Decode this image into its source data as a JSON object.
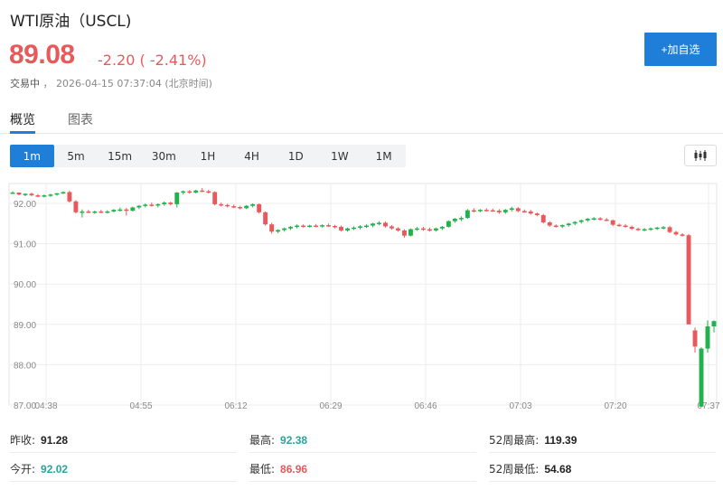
{
  "header": {
    "title": "WTI原油（USCL)",
    "price": "89.08",
    "change": "-2.20 ( -2.41%)",
    "state": "交易中",
    "timestamp": "2026-04-15 07:37:04 (北京时间)",
    "watch_label": "+加自选"
  },
  "tabs": [
    {
      "label": "概览",
      "active": true
    },
    {
      "label": "图表",
      "active": false
    }
  ],
  "periods": [
    {
      "label": "1m",
      "active": true
    },
    {
      "label": "5m",
      "active": false
    },
    {
      "label": "15m",
      "active": false
    },
    {
      "label": "30m",
      "active": false
    },
    {
      "label": "1H",
      "active": false
    },
    {
      "label": "4H",
      "active": false
    },
    {
      "label": "1D",
      "active": false
    },
    {
      "label": "1W",
      "active": false
    },
    {
      "label": "1M",
      "active": false
    }
  ],
  "chart_type_icon": "candlestick-icon",
  "stats": [
    {
      "label": "昨收:",
      "value": "91.28",
      "tone": "neutral"
    },
    {
      "label": "最高:",
      "value": "92.38",
      "tone": "up"
    },
    {
      "label": "52周最高:",
      "value": "119.39",
      "tone": "neutral"
    },
    {
      "label": "今开:",
      "value": "92.02",
      "tone": "up"
    },
    {
      "label": "最低:",
      "value": "86.96",
      "tone": "down"
    },
    {
      "label": "52周最低:",
      "value": "54.68",
      "tone": "neutral"
    }
  ],
  "colors": {
    "up": "#26a69a",
    "down": "#e8595b",
    "accent": "#1e7ed8",
    "candle_up": "#22b14c"
  },
  "chart_data": {
    "type": "candlestick",
    "ylim": [
      86.96,
      92.4
    ],
    "y_ticks": [
      "92.00",
      "91.00",
      "90.00",
      "89.00",
      "88.00",
      "87.00"
    ],
    "x_ticks": [
      "04:38",
      "04:55",
      "06:12",
      "06:29",
      "06:46",
      "07:03",
      "07:20",
      "07:37"
    ],
    "grid": true,
    "candles": [
      [
        92.27,
        92.3,
        92.24,
        92.27
      ],
      [
        92.27,
        92.27,
        92.2,
        92.22
      ],
      [
        92.22,
        92.25,
        92.18,
        92.24
      ],
      [
        92.24,
        92.27,
        92.18,
        92.2
      ],
      [
        92.2,
        92.23,
        92.15,
        92.17
      ],
      [
        92.17,
        92.22,
        92.15,
        92.2
      ],
      [
        92.2,
        92.24,
        92.16,
        92.22
      ],
      [
        92.22,
        92.26,
        92.19,
        92.25
      ],
      [
        92.25,
        92.3,
        92.23,
        92.28
      ],
      [
        92.28,
        92.32,
        92.02,
        92.05
      ],
      [
        92.05,
        92.08,
        91.75,
        91.78
      ],
      [
        91.78,
        91.85,
        91.65,
        91.8
      ],
      [
        91.8,
        91.84,
        91.76,
        91.78
      ],
      [
        91.78,
        91.82,
        91.74,
        91.8
      ],
      [
        91.8,
        91.84,
        91.76,
        91.79
      ],
      [
        91.79,
        91.83,
        91.75,
        91.8
      ],
      [
        91.8,
        91.86,
        91.78,
        91.84
      ],
      [
        91.84,
        91.9,
        91.8,
        91.85
      ],
      [
        91.85,
        91.89,
        91.7,
        91.82
      ],
      [
        91.82,
        91.92,
        91.8,
        91.9
      ],
      [
        91.9,
        91.96,
        91.86,
        91.94
      ],
      [
        91.94,
        92.0,
        91.9,
        91.97
      ],
      [
        91.97,
        92.02,
        91.92,
        91.95
      ],
      [
        91.95,
        92.0,
        91.9,
        91.98
      ],
      [
        91.98,
        92.05,
        91.94,
        92.02
      ],
      [
        92.02,
        92.04,
        91.95,
        91.98
      ],
      [
        91.98,
        92.28,
        91.9,
        92.27
      ],
      [
        92.27,
        92.32,
        92.22,
        92.3
      ],
      [
        92.3,
        92.33,
        92.24,
        92.27
      ],
      [
        92.27,
        92.34,
        92.25,
        92.32
      ],
      [
        92.32,
        92.38,
        92.28,
        92.3
      ],
      [
        92.3,
        92.34,
        92.25,
        92.28
      ],
      [
        92.28,
        92.3,
        91.95,
        91.98
      ],
      [
        91.98,
        92.02,
        91.92,
        91.96
      ],
      [
        91.96,
        91.99,
        91.9,
        91.93
      ],
      [
        91.93,
        91.97,
        91.88,
        91.91
      ],
      [
        91.91,
        91.94,
        91.85,
        91.88
      ],
      [
        91.88,
        91.96,
        91.86,
        91.94
      ],
      [
        91.94,
        92.0,
        91.9,
        91.98
      ],
      [
        91.98,
        92.0,
        91.75,
        91.78
      ],
      [
        91.78,
        91.8,
        91.45,
        91.48
      ],
      [
        91.48,
        91.52,
        91.25,
        91.3
      ],
      [
        91.3,
        91.36,
        91.26,
        91.34
      ],
      [
        91.34,
        91.4,
        91.3,
        91.38
      ],
      [
        91.38,
        91.44,
        91.34,
        91.42
      ],
      [
        91.42,
        91.48,
        91.38,
        91.45
      ],
      [
        91.45,
        91.48,
        91.4,
        91.43
      ],
      [
        91.43,
        91.47,
        91.4,
        91.45
      ],
      [
        91.45,
        91.49,
        91.41,
        91.44
      ],
      [
        91.44,
        91.48,
        91.4,
        91.46
      ],
      [
        91.46,
        91.5,
        91.42,
        91.44
      ],
      [
        91.44,
        91.47,
        91.38,
        91.42
      ],
      [
        91.42,
        91.45,
        91.3,
        91.33
      ],
      [
        91.33,
        91.4,
        91.3,
        91.38
      ],
      [
        91.38,
        91.43,
        91.34,
        91.4
      ],
      [
        91.4,
        91.46,
        91.36,
        91.43
      ],
      [
        91.43,
        91.48,
        91.39,
        91.45
      ],
      [
        91.45,
        91.52,
        91.41,
        91.5
      ],
      [
        91.5,
        91.56,
        91.46,
        91.52
      ],
      [
        91.52,
        91.55,
        91.4,
        91.43
      ],
      [
        91.43,
        91.46,
        91.35,
        91.38
      ],
      [
        91.38,
        91.41,
        91.3,
        91.33
      ],
      [
        91.33,
        91.36,
        91.15,
        91.2
      ],
      [
        91.2,
        91.38,
        91.18,
        91.36
      ],
      [
        91.36,
        91.42,
        91.32,
        91.38
      ],
      [
        91.38,
        91.42,
        91.32,
        91.36
      ],
      [
        91.36,
        91.4,
        91.3,
        91.33
      ],
      [
        91.33,
        91.4,
        91.3,
        91.38
      ],
      [
        91.38,
        91.44,
        91.34,
        91.42
      ],
      [
        91.42,
        91.58,
        91.4,
        91.56
      ],
      [
        91.56,
        91.64,
        91.52,
        91.62
      ],
      [
        91.62,
        91.68,
        91.56,
        91.64
      ],
      [
        91.64,
        91.86,
        91.62,
        91.83
      ],
      [
        91.83,
        91.88,
        91.78,
        91.82
      ],
      [
        91.82,
        91.86,
        91.78,
        91.84
      ],
      [
        91.84,
        91.88,
        91.8,
        91.83
      ],
      [
        91.83,
        91.87,
        91.79,
        91.82
      ],
      [
        91.82,
        91.86,
        91.74,
        91.78
      ],
      [
        91.78,
        91.86,
        91.74,
        91.84
      ],
      [
        91.84,
        91.92,
        91.8,
        91.88
      ],
      [
        91.88,
        91.91,
        91.78,
        91.81
      ],
      [
        91.81,
        91.85,
        91.77,
        91.8
      ],
      [
        91.8,
        91.84,
        91.72,
        91.75
      ],
      [
        91.75,
        91.78,
        91.68,
        91.71
      ],
      [
        91.71,
        91.74,
        91.5,
        91.53
      ],
      [
        91.53,
        91.56,
        91.42,
        91.45
      ],
      [
        91.45,
        91.48,
        91.4,
        91.43
      ],
      [
        91.43,
        91.48,
        91.39,
        91.46
      ],
      [
        91.46,
        91.52,
        91.42,
        91.5
      ],
      [
        91.5,
        91.56,
        91.46,
        91.54
      ],
      [
        91.54,
        91.6,
        91.5,
        91.58
      ],
      [
        91.58,
        91.64,
        91.54,
        91.62
      ],
      [
        91.62,
        91.66,
        91.58,
        91.63
      ],
      [
        91.63,
        91.66,
        91.58,
        91.6
      ],
      [
        91.6,
        91.64,
        91.56,
        91.58
      ],
      [
        91.58,
        91.6,
        91.44,
        91.47
      ],
      [
        91.47,
        91.5,
        91.42,
        91.45
      ],
      [
        91.45,
        91.49,
        91.4,
        91.42
      ],
      [
        91.42,
        91.45,
        91.34,
        91.37
      ],
      [
        91.37,
        91.4,
        91.32,
        91.35
      ],
      [
        91.35,
        91.39,
        91.31,
        91.36
      ],
      [
        91.36,
        91.4,
        91.32,
        91.38
      ],
      [
        91.38,
        91.42,
        91.34,
        91.4
      ],
      [
        91.4,
        91.44,
        91.36,
        91.41
      ],
      [
        91.41,
        91.44,
        91.26,
        91.29
      ],
      [
        91.29,
        91.32,
        91.2,
        91.23
      ],
      [
        91.23,
        91.26,
        91.18,
        91.21
      ],
      [
        91.21,
        91.24,
        90.98,
        89.0
      ],
      [
        88.85,
        88.92,
        88.3,
        88.45
      ],
      [
        86.96,
        88.43,
        86.96,
        88.4
      ],
      [
        88.4,
        89.1,
        88.3,
        88.95
      ],
      [
        88.95,
        89.1,
        88.8,
        89.08
      ]
    ]
  }
}
